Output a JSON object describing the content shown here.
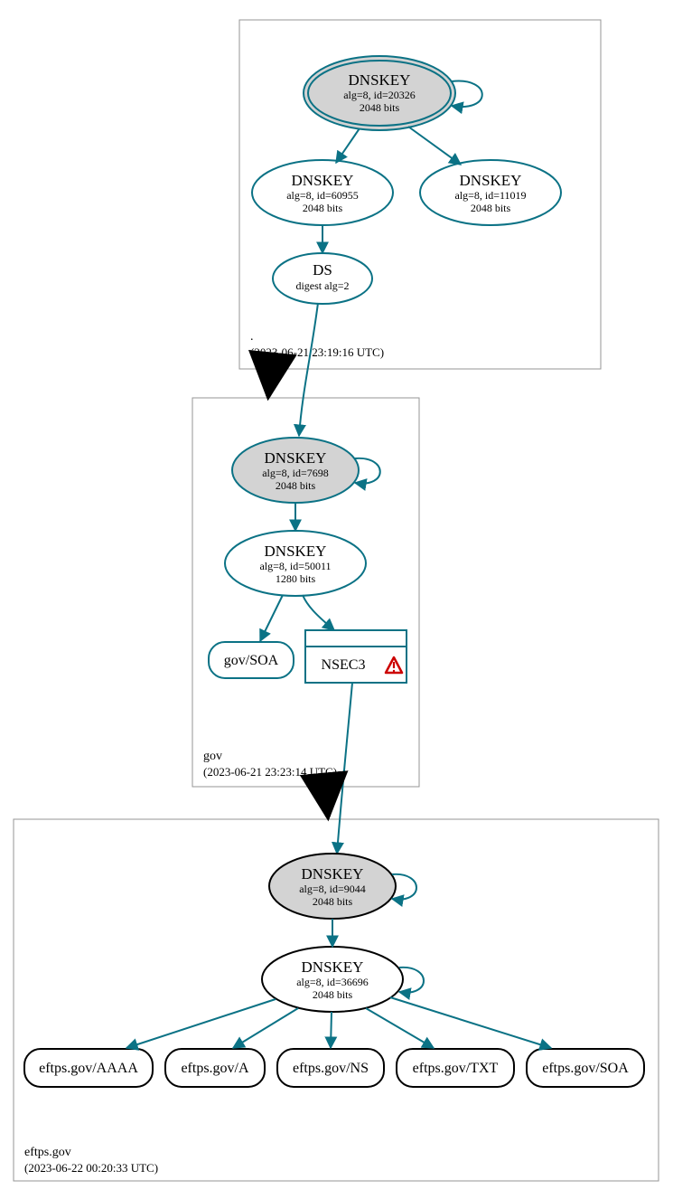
{
  "colors": {
    "teal": "#0b7285",
    "black": "#000000",
    "gray_fill": "#d3d3d3",
    "stroke_gray": "#949494",
    "red": "#cc0000"
  },
  "zones": {
    "root": {
      "label": ".",
      "timestamp": "(2023-06-21 23:19:16 UTC)",
      "nodes": {
        "ksk": {
          "title": "DNSKEY",
          "line2": "alg=8, id=20326",
          "line3": "2048 bits"
        },
        "zsk1": {
          "title": "DNSKEY",
          "line2": "alg=8, id=60955",
          "line3": "2048 bits"
        },
        "zsk2": {
          "title": "DNSKEY",
          "line2": "alg=8, id=11019",
          "line3": "2048 bits"
        },
        "ds": {
          "title": "DS",
          "line2": "digest alg=2"
        }
      }
    },
    "gov": {
      "label": "gov",
      "timestamp": "(2023-06-21 23:23:14 UTC)",
      "nodes": {
        "ksk": {
          "title": "DNSKEY",
          "line2": "alg=8, id=7698",
          "line3": "2048 bits"
        },
        "zsk": {
          "title": "DNSKEY",
          "line2": "alg=8, id=50011",
          "line3": "1280 bits"
        },
        "soa": {
          "title": "gov/SOA"
        },
        "nsec3": {
          "title": "NSEC3"
        }
      }
    },
    "eftps": {
      "label": "eftps.gov",
      "timestamp": "(2023-06-22 00:20:33 UTC)",
      "nodes": {
        "ksk": {
          "title": "DNSKEY",
          "line2": "alg=8, id=9044",
          "line3": "2048 bits"
        },
        "zsk": {
          "title": "DNSKEY",
          "line2": "alg=8, id=36696",
          "line3": "2048 bits"
        },
        "aaaa": {
          "title": "eftps.gov/AAAA"
        },
        "a": {
          "title": "eftps.gov/A"
        },
        "ns": {
          "title": "eftps.gov/NS"
        },
        "txt": {
          "title": "eftps.gov/TXT"
        },
        "soa": {
          "title": "eftps.gov/SOA"
        }
      }
    }
  }
}
